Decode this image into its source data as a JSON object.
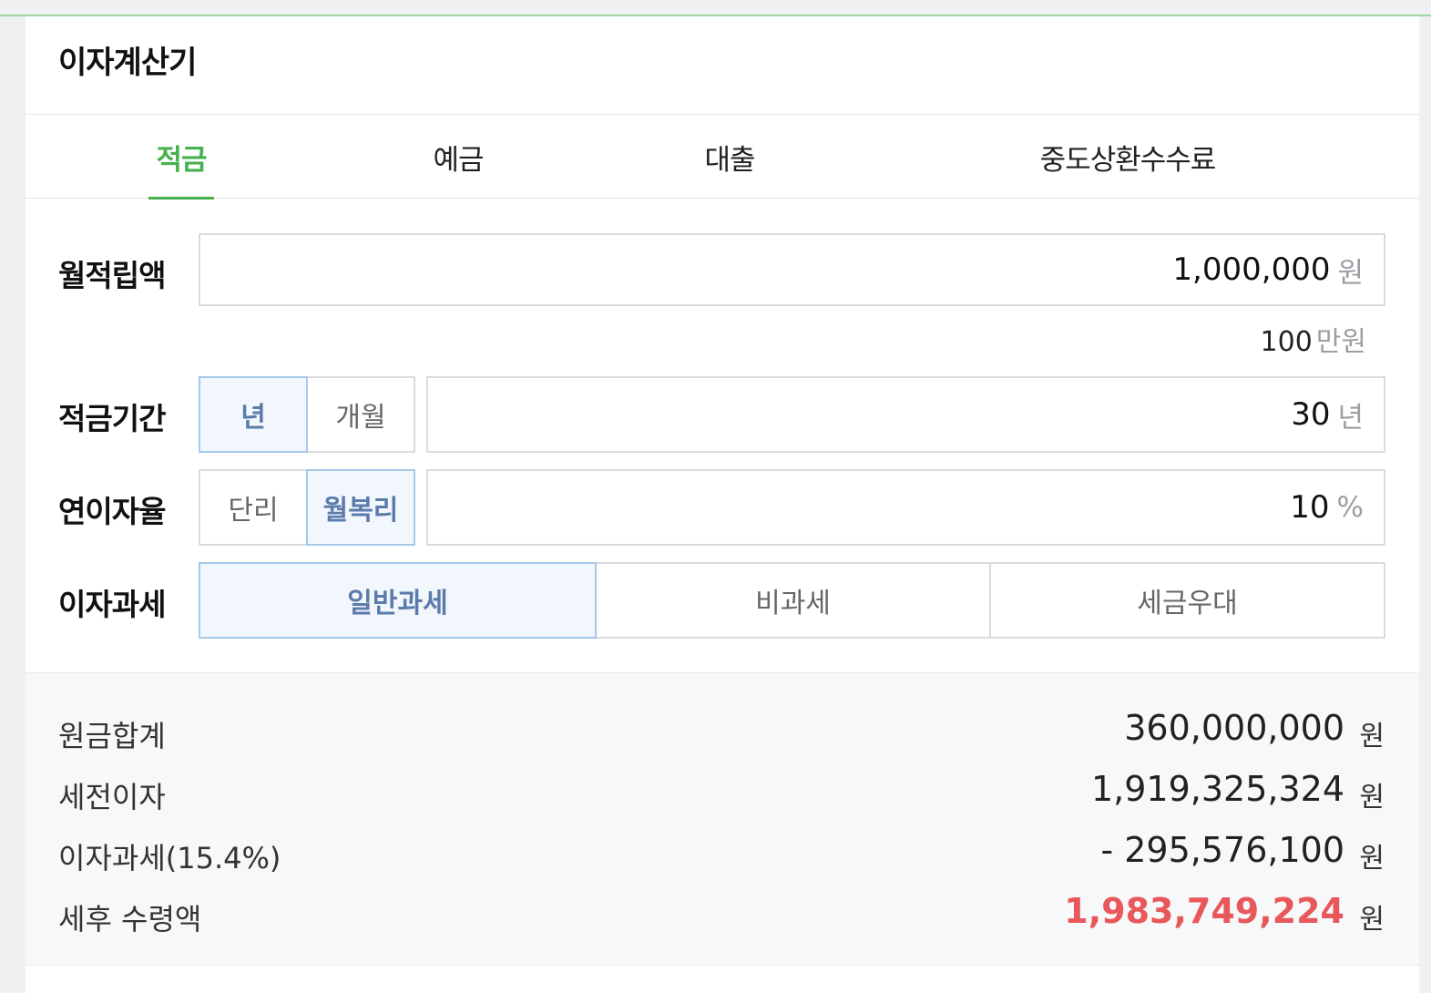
{
  "header": {
    "title": "이자계산기"
  },
  "tabs": [
    {
      "label": "적금",
      "active": true
    },
    {
      "label": "예금",
      "active": false
    },
    {
      "label": "대출",
      "active": false
    },
    {
      "label": "중도상환수수료",
      "active": false
    }
  ],
  "monthly_deposit": {
    "label": "월적립액",
    "value": "1,000,000",
    "unit": "원",
    "hint_value": "100",
    "hint_unit": "만원"
  },
  "period": {
    "label": "적금기간",
    "options": [
      "년",
      "개월"
    ],
    "selected": "년",
    "value": "30",
    "unit": "년"
  },
  "rate": {
    "label": "연이자율",
    "options": [
      "단리",
      "월복리"
    ],
    "selected": "월복리",
    "value": "10",
    "unit": "%"
  },
  "tax": {
    "label": "이자과세",
    "options": [
      "일반과세",
      "비과세",
      "세금우대"
    ],
    "selected": "일반과세"
  },
  "results": {
    "principal": {
      "label": "원금합계",
      "value": "360,000,000",
      "unit": "원"
    },
    "pretax_interest": {
      "label": "세전이자",
      "value": "1,919,325,324",
      "unit": "원"
    },
    "interest_tax": {
      "label": "이자과세(15.4%)",
      "value": "- 295,576,100",
      "unit": "원"
    },
    "after_tax": {
      "label": "세후 수령액",
      "value": "1,983,749,224",
      "unit": "원"
    }
  },
  "colors": {
    "accent_green": "#47b14d",
    "selected_blue": "#5b7bab",
    "highlight_red": "#e8575a"
  }
}
